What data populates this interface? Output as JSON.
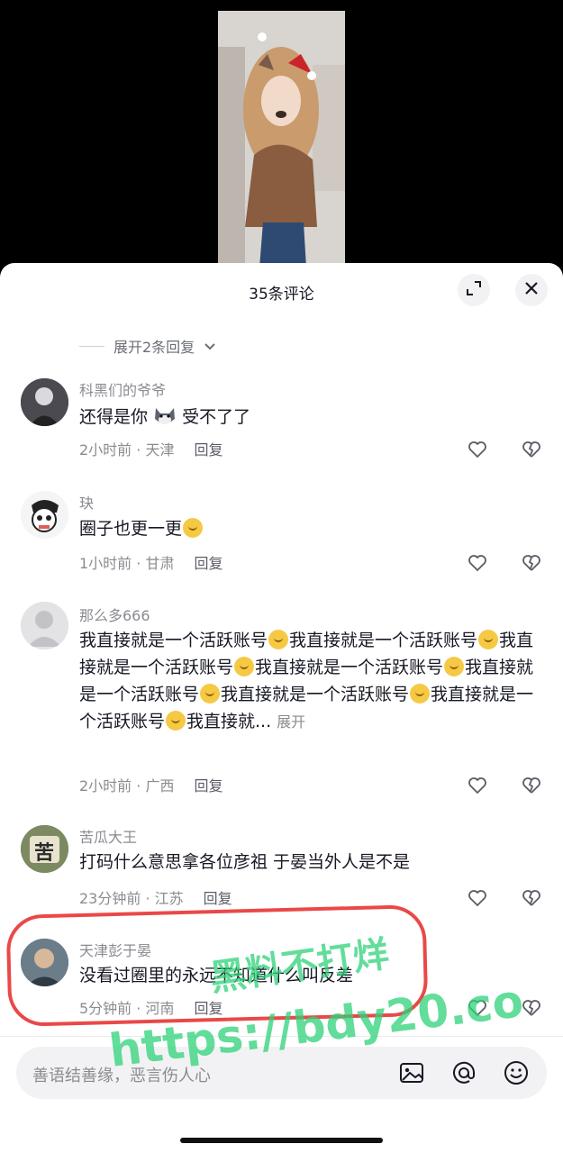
{
  "header": {
    "title": "35条评论"
  },
  "expand_replies": "展开2条回复",
  "comments": [
    {
      "user": "科黑们的爷爷",
      "text_before": "还得是你",
      "text_after": " 受不了了",
      "time": "2小时前 · 天津",
      "reply": "回复"
    },
    {
      "user": "玦",
      "text": "圈子也更一更",
      "time": "1小时前 · 甘肃",
      "reply": "回复"
    },
    {
      "user": "那么多666",
      "text_segments": [
        "我直接就是一个活跃账号",
        "我直接就是一个活跃账号",
        "我直接就是一个活跃账号",
        "我直接就是一个活跃账号",
        "我直接就是一个活跃账号",
        "我直接就是一个活跃账号",
        "我直接就是一个活跃账号",
        "我直接就..."
      ],
      "more": "展开",
      "time": "2小时前 · 广西",
      "reply": "回复"
    },
    {
      "user": "苦瓜大王",
      "avatar_text": "苦",
      "text": "打码什么意思拿各位彦祖 于晏当外人是不是",
      "time": "23分钟前 · 江苏",
      "reply": "回复"
    },
    {
      "user": "天津彭于晏",
      "text": "没看过圈里的永远不知道什么叫反差",
      "time": "5分钟前 · 河南",
      "reply": "回复"
    }
  ],
  "input": {
    "placeholder": "善语结善缘，恶言伤人心"
  },
  "watermark": {
    "line1": "黑料不打烊",
    "line2": "https://bdy20.co"
  },
  "icons": {
    "expand": "expand-icon",
    "close": "close-icon",
    "like": "heart-icon",
    "dislike": "broken-heart-icon",
    "image": "image-icon",
    "mention": "at-icon",
    "emoji": "emoji-icon"
  },
  "colors": {
    "sheet": "#ffffff",
    "meta": "#8a8b91",
    "watermark": "#2dd278",
    "circle": "#e62828"
  }
}
